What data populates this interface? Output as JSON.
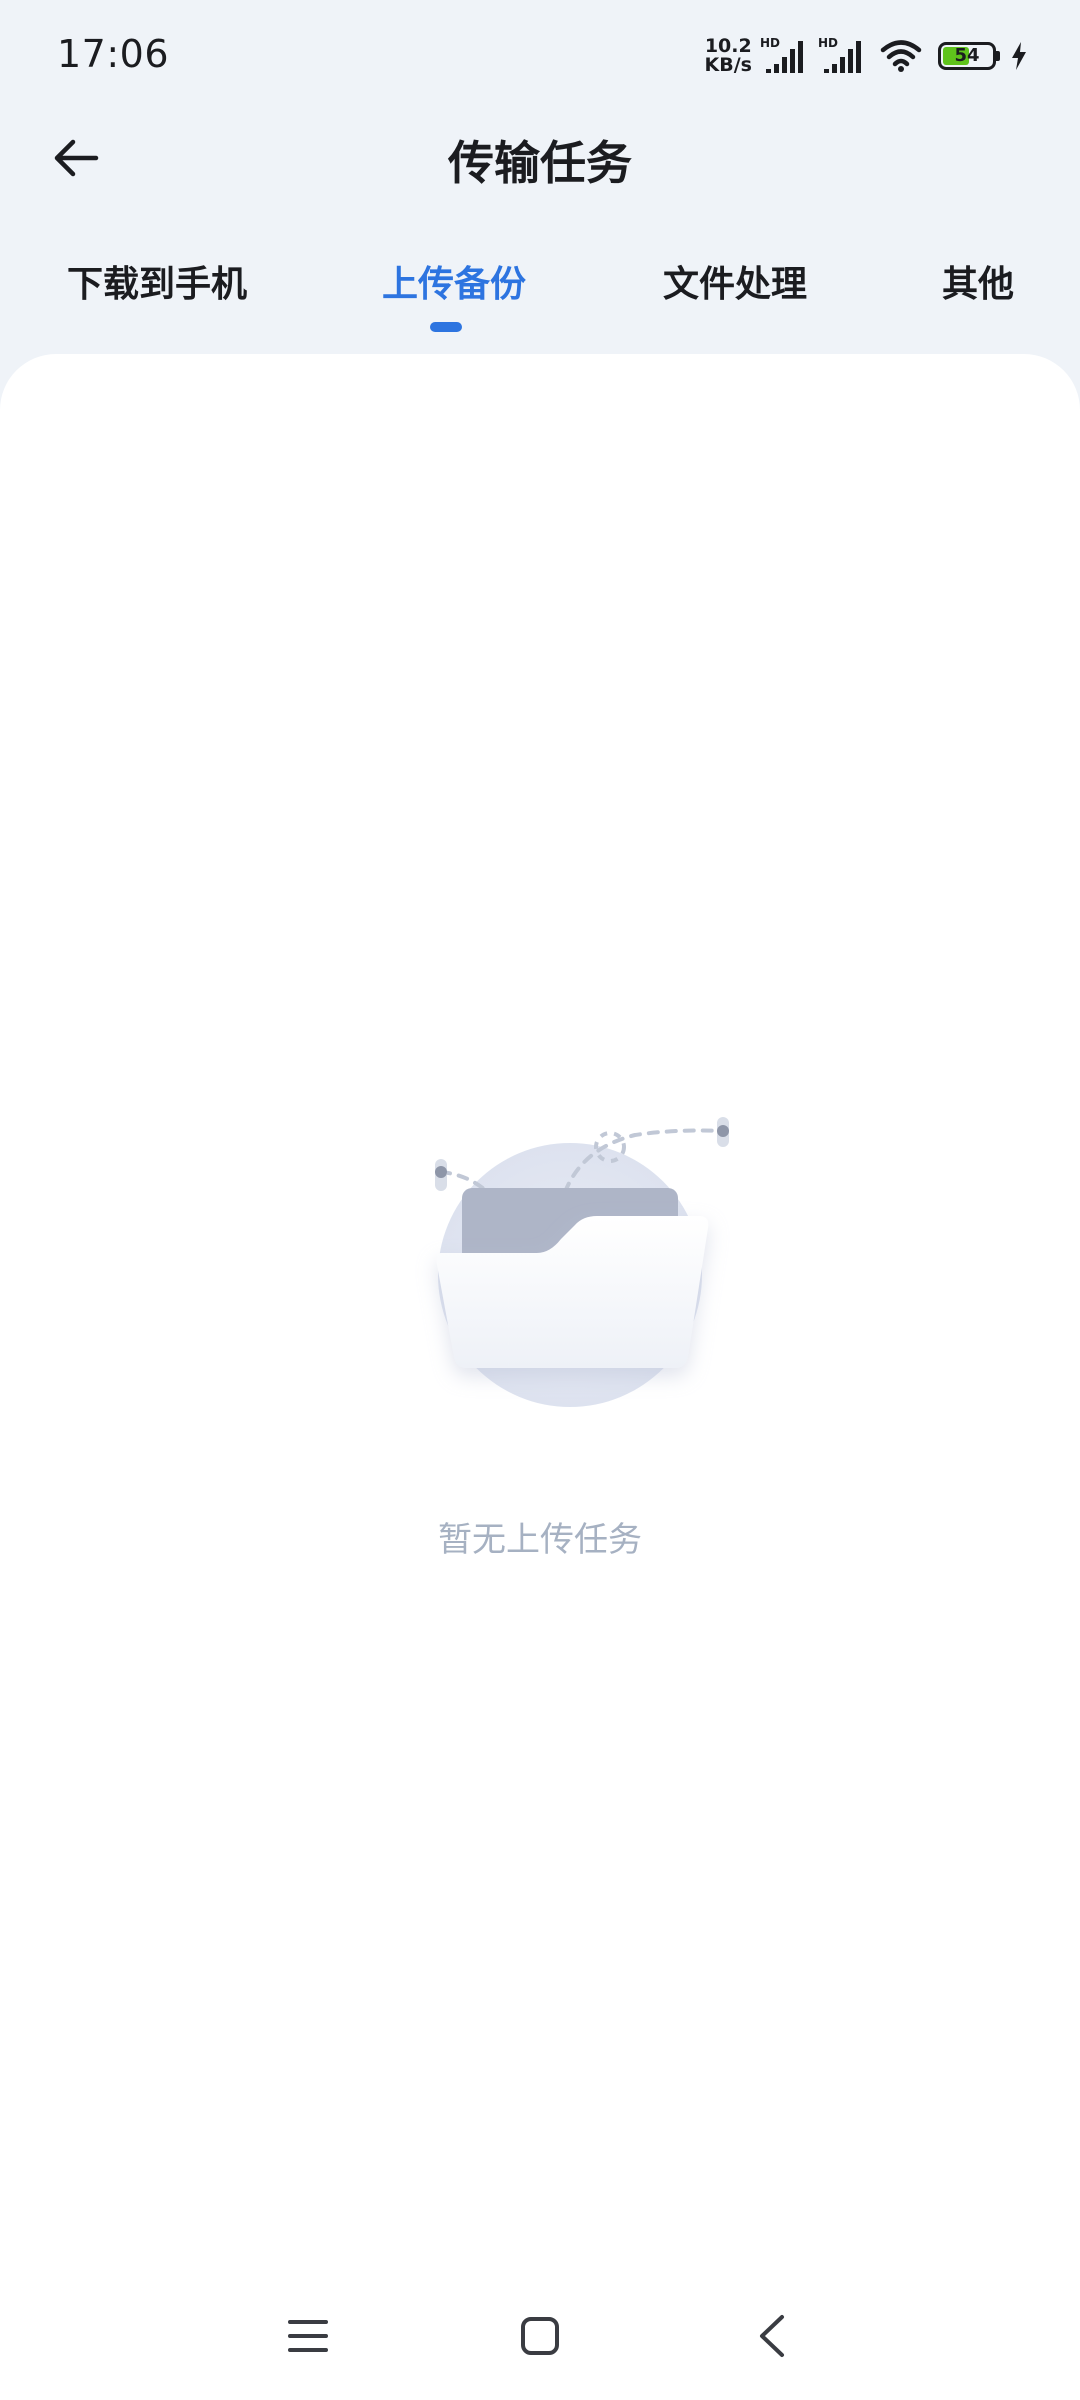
{
  "status_bar": {
    "time": "17:06",
    "net_speed_value": "10.2",
    "net_speed_unit": "KB/s",
    "sim1_label": "HD",
    "sim2_label": "HD",
    "battery_level": "54",
    "battery_fraction": 0.54,
    "battery_color": "#5fc31c",
    "charging": true
  },
  "header": {
    "back_icon": "arrow-left-icon",
    "title": "传输任务"
  },
  "tabs": [
    {
      "label": "下载到手机",
      "active": false
    },
    {
      "label": "上传备份",
      "active": true
    },
    {
      "label": "文件处理",
      "active": false
    },
    {
      "label": "其他",
      "active": false
    }
  ],
  "accent_color": "#2d74e0",
  "empty_state": {
    "illustration": "empty-folder-icon",
    "message": "暂无上传任务"
  },
  "nav_bar": {
    "menu_icon": "menu-icon",
    "home_icon": "home-icon",
    "back_icon": "back-chevron-icon"
  }
}
